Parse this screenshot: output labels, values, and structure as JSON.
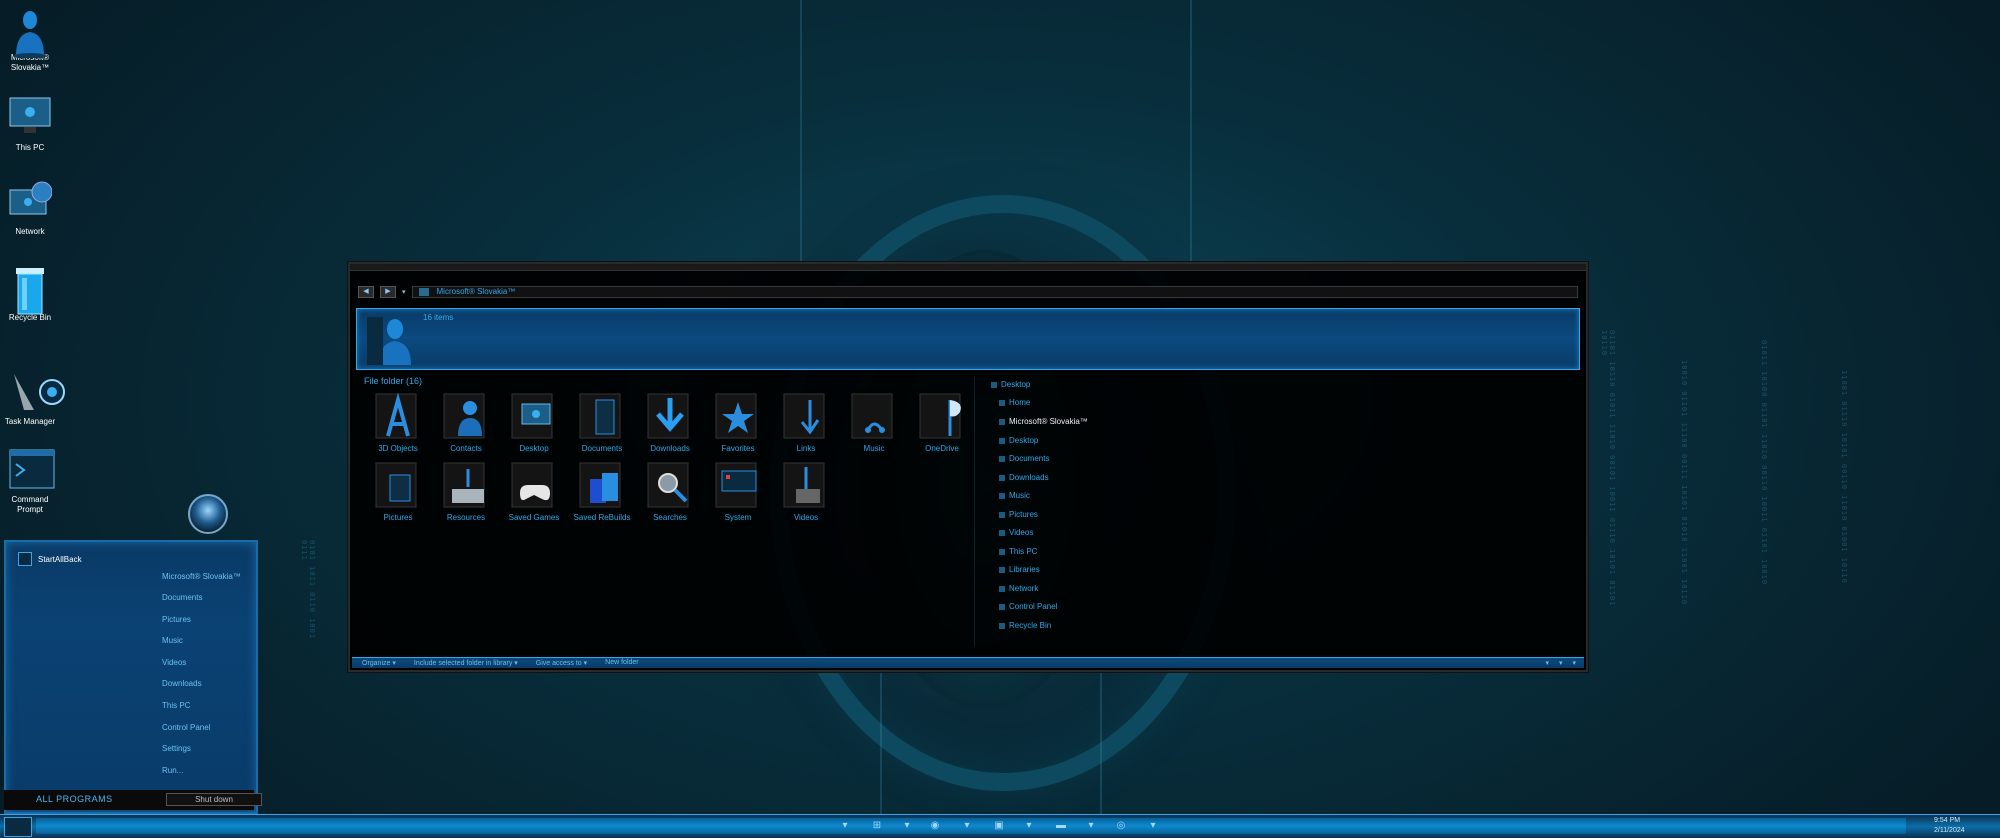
{
  "desktop": {
    "icons": [
      {
        "label": "Microsoft® Slovakia™",
        "icon": "user-icon"
      },
      {
        "label": "This PC",
        "icon": "monitor-icon"
      },
      {
        "label": "Network",
        "icon": "network-icon"
      },
      {
        "label": "Recycle Bin",
        "icon": "recycle-bin-icon"
      },
      {
        "label": "Task Manager",
        "icon": "task-manager-icon"
      },
      {
        "label": "Command Prompt",
        "icon": "command-prompt-icon"
      }
    ]
  },
  "explorer": {
    "address": "Microsoft® Slovakia™",
    "item_count": "16 items",
    "group_header": "File folder (16)",
    "folders": [
      "3D Objects",
      "Contacts",
      "Desktop",
      "Documents",
      "Downloads",
      "Favorites",
      "Links",
      "Music",
      "OneDrive",
      "Pictures",
      "Resources",
      "Saved Games",
      "Saved ReBuilds",
      "Searches",
      "System",
      "Videos"
    ],
    "tree": [
      {
        "label": "Desktop",
        "level": 0
      },
      {
        "label": "Home",
        "level": 1
      },
      {
        "label": "Microsoft® Slovakia™",
        "level": 1,
        "selected": true
      },
      {
        "label": "Desktop",
        "level": 1
      },
      {
        "label": "Documents",
        "level": 1
      },
      {
        "label": "Downloads",
        "level": 1
      },
      {
        "label": "Music",
        "level": 1
      },
      {
        "label": "Pictures",
        "level": 1
      },
      {
        "label": "Videos",
        "level": 1
      },
      {
        "label": "This PC",
        "level": 1
      },
      {
        "label": "Libraries",
        "level": 1
      },
      {
        "label": "Network",
        "level": 1
      },
      {
        "label": "Control Panel",
        "level": 1
      },
      {
        "label": "Recycle Bin",
        "level": 1
      }
    ],
    "commands": [
      "Organize ▾",
      "Include selected folder in library ▾",
      "Give access to ▾",
      "New folder"
    ]
  },
  "start_menu": {
    "user": "StartAllBack",
    "items": [
      "Microsoft® Slovakia™",
      "Documents",
      "Pictures",
      "Music",
      "Videos",
      "Downloads",
      "This PC",
      "Control Panel",
      "Settings",
      "Run..."
    ],
    "all_programs": "ALL PROGRAMS",
    "shutdown": "Shut down"
  },
  "taskbar": {
    "time": "9:54 PM",
    "date": "2/11/2024"
  },
  "colors": {
    "accent": "#2fa8e8",
    "panel": "#0a3a66",
    "window_bg": "#000000"
  }
}
